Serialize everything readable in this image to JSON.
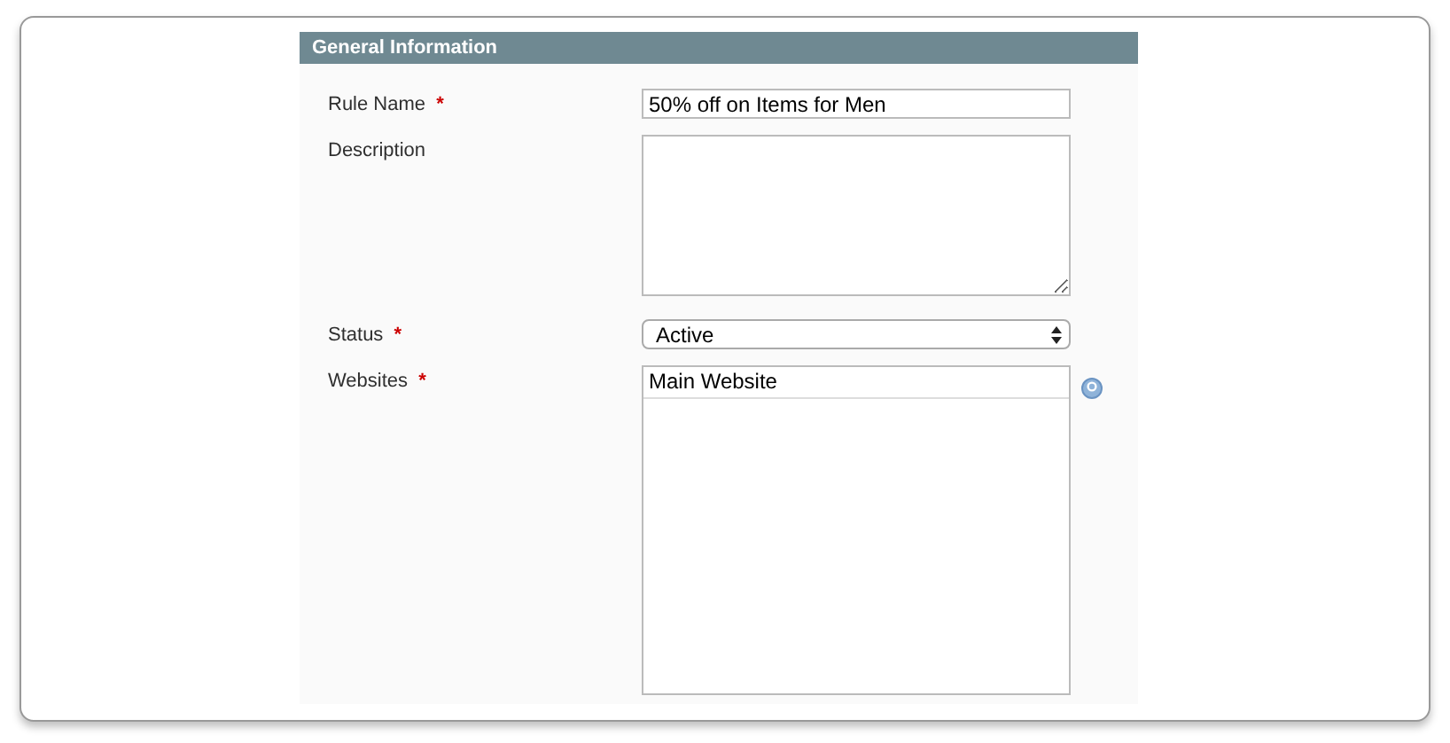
{
  "section": {
    "title": "General Information"
  },
  "fields": [
    {
      "kind": "text",
      "label": "Rule Name",
      "required_mark": "*",
      "value": "50% off on Items for Men"
    },
    {
      "kind": "textarea",
      "label": "Description"
    },
    {
      "kind": "select",
      "label": "Status",
      "required_mark": "*",
      "value": "Active"
    },
    {
      "kind": "multiselect",
      "label": "Websites",
      "required_mark": "*",
      "options": [
        {
          "label": "Main Website",
          "selected": false
        }
      ],
      "help": true
    }
  ]
}
